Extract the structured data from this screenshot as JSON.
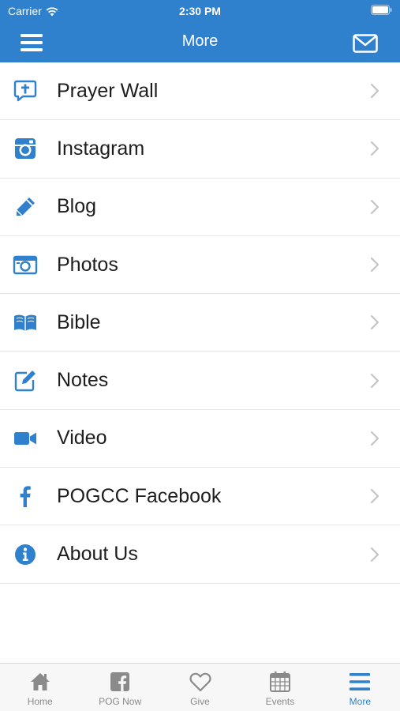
{
  "status_bar": {
    "carrier": "Carrier",
    "time": "2:30 PM"
  },
  "nav": {
    "title": "More",
    "left_icon": "hamburger-menu-icon",
    "right_icon": "mail-icon"
  },
  "colors": {
    "accent": "#2f80cd",
    "tab_inactive": "#8a8a8a",
    "divider": "#e6e6e6"
  },
  "menu": [
    {
      "label": "Prayer Wall",
      "icon": "prayer-wall-icon"
    },
    {
      "label": "Instagram",
      "icon": "instagram-icon"
    },
    {
      "label": "Blog",
      "icon": "pencil-icon"
    },
    {
      "label": "Photos",
      "icon": "camera-icon"
    },
    {
      "label": "Bible",
      "icon": "book-icon"
    },
    {
      "label": "Notes",
      "icon": "notes-icon"
    },
    {
      "label": "Video",
      "icon": "video-camera-icon"
    },
    {
      "label": "POGCC Facebook",
      "icon": "facebook-icon"
    },
    {
      "label": "About Us",
      "icon": "info-icon"
    }
  ],
  "tabs": [
    {
      "label": "Home",
      "icon": "home-icon",
      "active": false
    },
    {
      "label": "POG Now",
      "icon": "facebook-square-icon",
      "active": false
    },
    {
      "label": "Give",
      "icon": "heart-icon",
      "active": false
    },
    {
      "label": "Events",
      "icon": "calendar-icon",
      "active": false
    },
    {
      "label": "More",
      "icon": "menu-icon",
      "active": true
    }
  ]
}
